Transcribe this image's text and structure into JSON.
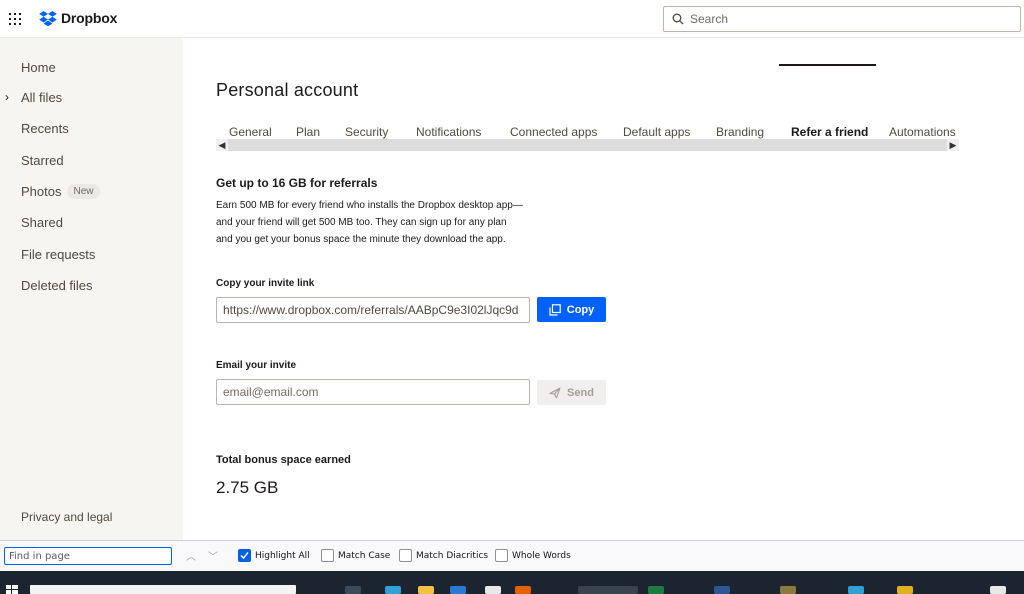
{
  "app": {
    "brand": "Dropbox",
    "brand_color": "#0061fe"
  },
  "header": {
    "search_placeholder": "Search"
  },
  "sidebar": {
    "items": [
      {
        "label": "Home"
      },
      {
        "label": "All files"
      },
      {
        "label": "Recents"
      },
      {
        "label": "Starred"
      },
      {
        "label": "Photos",
        "badge": "New"
      },
      {
        "label": "Shared"
      },
      {
        "label": "File requests"
      },
      {
        "label": "Deleted files"
      }
    ],
    "footer": "Privacy and legal"
  },
  "main": {
    "title": "Personal account",
    "tabs": [
      {
        "label": "General"
      },
      {
        "label": "Plan"
      },
      {
        "label": "Security"
      },
      {
        "label": "Notifications"
      },
      {
        "label": "Connected apps"
      },
      {
        "label": "Default apps"
      },
      {
        "label": "Branding"
      },
      {
        "label": "Refer a friend",
        "active": true
      },
      {
        "label": "Automations"
      }
    ],
    "referral": {
      "heading": "Get up to 16 GB for referrals",
      "desc_line1": "Earn 500 MB for every friend who installs the Dropbox desktop app—",
      "desc_line2": "and your friend will get 500 MB too. They can sign up for any plan",
      "desc_line3": "and you get your bonus space the minute they download the app.",
      "invite_link_label": "Copy your invite link",
      "invite_link_value": "https://www.dropbox.com/referrals/AABpC9e3I02lJqc9d",
      "copy_button": "Copy",
      "email_label": "Email your invite",
      "email_placeholder": "email@email.com",
      "send_button": "Send",
      "bonus_label": "Total bonus space earned",
      "bonus_value": "2.75 GB"
    }
  },
  "findbar": {
    "placeholder": "Find in page",
    "options": [
      {
        "label": "Highlight All",
        "checked": true
      },
      {
        "label": "Match Case",
        "checked": false
      },
      {
        "label": "Match Diacritics",
        "checked": false
      },
      {
        "label": "Whole Words",
        "checked": false
      }
    ]
  }
}
